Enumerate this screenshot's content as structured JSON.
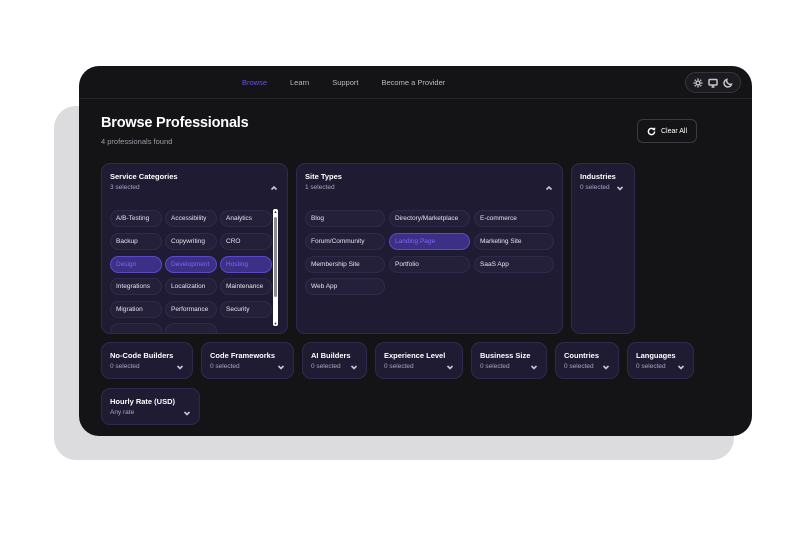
{
  "nav": {
    "items": [
      {
        "label": "Browse",
        "active": true
      },
      {
        "label": "Learn",
        "active": false
      },
      {
        "label": "Support",
        "active": false
      },
      {
        "label": "Become a Provider",
        "active": false
      }
    ]
  },
  "theme_switcher": {
    "icons": [
      "sun-icon",
      "monitor-icon",
      "moon-icon"
    ]
  },
  "header": {
    "title": "Browse Professionals",
    "count_text": "4 professionals found",
    "clear_all_label": "Clear All"
  },
  "colors": {
    "accent": "#6d4ef0",
    "panel": "#1f1b33",
    "background": "#141416"
  },
  "service_categories": {
    "title": "Service Categories",
    "selected_text": "3 selected",
    "items": [
      {
        "label": "A/B-Testing",
        "selected": false
      },
      {
        "label": "Accessibility",
        "selected": false
      },
      {
        "label": "Analytics",
        "selected": false
      },
      {
        "label": "Backup",
        "selected": false
      },
      {
        "label": "Copywriting",
        "selected": false
      },
      {
        "label": "CRO",
        "selected": false
      },
      {
        "label": "Design",
        "selected": true
      },
      {
        "label": "Development",
        "selected": true
      },
      {
        "label": "Hosting",
        "selected": true
      },
      {
        "label": "Integrations",
        "selected": false
      },
      {
        "label": "Localization",
        "selected": false
      },
      {
        "label": "Maintenance",
        "selected": false
      },
      {
        "label": "Migration",
        "selected": false
      },
      {
        "label": "Performance",
        "selected": false
      },
      {
        "label": "Security",
        "selected": false
      }
    ]
  },
  "site_types": {
    "title": "Site Types",
    "selected_text": "1 selected",
    "items": [
      {
        "label": "Blog",
        "selected": false
      },
      {
        "label": "Directory/Marketplace",
        "selected": false
      },
      {
        "label": "E-commerce",
        "selected": false
      },
      {
        "label": "Forum/Community",
        "selected": false
      },
      {
        "label": "Landing Page",
        "selected": true
      },
      {
        "label": "Marketing Site",
        "selected": false
      },
      {
        "label": "Membership Site",
        "selected": false
      },
      {
        "label": "Portfolio",
        "selected": false
      },
      {
        "label": "SaaS App",
        "selected": false
      },
      {
        "label": "Web App",
        "selected": false
      }
    ]
  },
  "industries": {
    "title": "Industries",
    "selected_text": "0 selected"
  },
  "filters": [
    {
      "title": "No-Code Builders",
      "value": "0 selected"
    },
    {
      "title": "Code Frameworks",
      "value": "0 selected"
    },
    {
      "title": "AI Builders",
      "value": "0 selected"
    },
    {
      "title": "Experience Level",
      "value": "0 selected"
    },
    {
      "title": "Business Size",
      "value": "0 selected"
    },
    {
      "title": "Countries",
      "value": "0 selected"
    },
    {
      "title": "Languages",
      "value": "0 selected"
    },
    {
      "title": "Hourly Rate (USD)",
      "value": "Any rate"
    }
  ]
}
